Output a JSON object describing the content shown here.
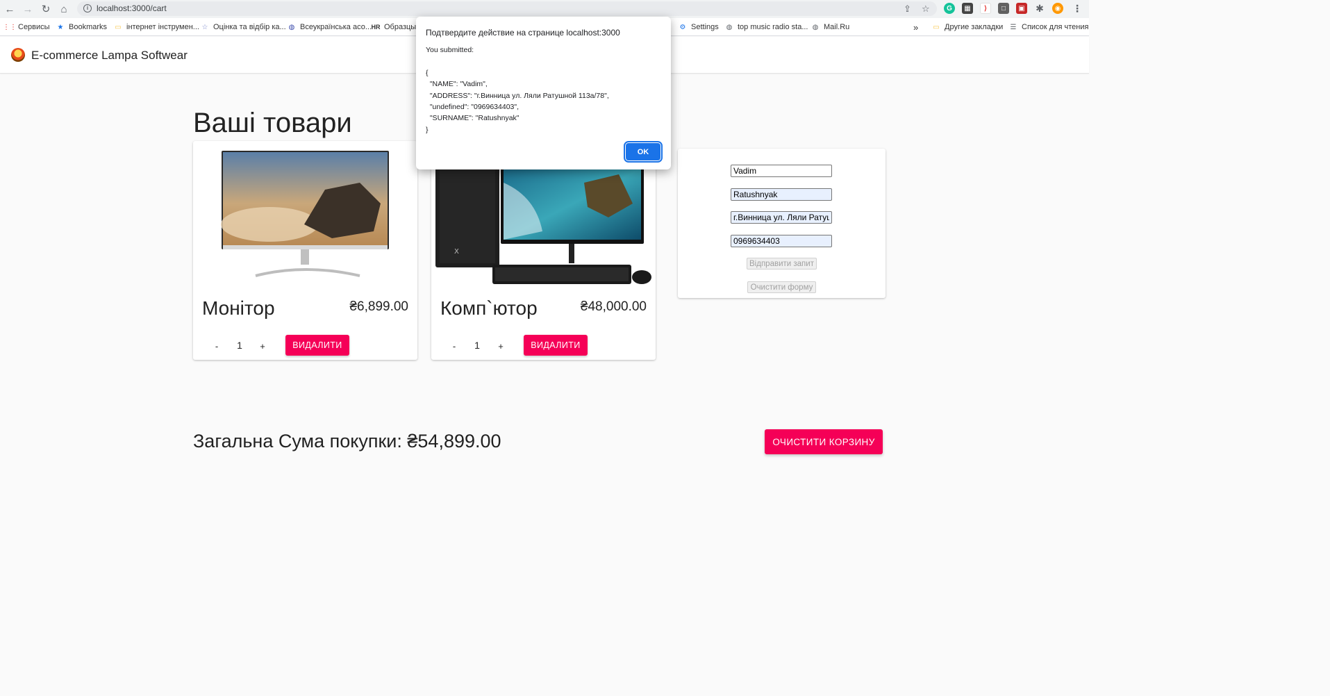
{
  "browser": {
    "url": "localhost:3000/cart",
    "bookmarks": [
      {
        "label": "Сервисы",
        "icon": "apps-grid-icon"
      },
      {
        "label": "Bookmarks",
        "icon": "star-icon"
      },
      {
        "label": "інтернет інструмен...",
        "icon": "folder-icon"
      },
      {
        "label": "Оцінка та відбір ка...",
        "icon": "star-outline-icon"
      },
      {
        "label": "Всеукраїнська асо...",
        "icon": "globe-icon"
      },
      {
        "label": "Образцы",
        "icon": "hr-icon"
      },
      {
        "label": "Settings",
        "icon": "gear-icon"
      },
      {
        "label": "top music radio sta...",
        "icon": "globe-icon"
      },
      {
        "label": "Mail.Ru",
        "icon": "globe-icon"
      },
      {
        "label": "Другие закладки",
        "icon": "folder-icon"
      },
      {
        "label": "Список для чтения",
        "icon": "reading-list-icon"
      }
    ],
    "more_label": "»"
  },
  "app": {
    "title": "E-commerce Lampa Softwear",
    "page_title": "Ваші товари"
  },
  "cart": {
    "items": [
      {
        "name": "Монітор",
        "price": "₴6,899.00",
        "quantity": "1",
        "minus": "-",
        "plus": "+",
        "delete_label": "ВИДАЛИТИ"
      },
      {
        "name": "Комп`ютор",
        "price": "₴48,000.00",
        "quantity": "1",
        "minus": "-",
        "plus": "+",
        "delete_label": "ВИДАЛИТИ"
      }
    ],
    "total_label": "Загальна Сума покупки: ₴54,899.00",
    "clear_label": "ОЧИСТИТИ КОРЗИНУ"
  },
  "form": {
    "name": "Vadim",
    "surname": "Ratushnyak",
    "address": "г.Винница ул. Ляли Ратушной 113а/78",
    "phone": "0969634403",
    "submit_label": "Відправити запит",
    "reset_label": "Очистити форму"
  },
  "dialog": {
    "title": "Подтвердите действие на странице localhost:3000",
    "message": "You submitted:\n\n{\n  \"NAME\": \"Vadim\",\n  \"ADDRESS\": \"г.Винница ул. Ляли Ратушной 113а/78\",\n  \"undefined\": \"0969634403\",\n  \"SURNAME\": \"Ratushnyak\"\n}",
    "ok_label": "OK"
  },
  "colors": {
    "accent": "#f50057",
    "dialog_button": "#1a73e8",
    "autofill": "#e8f0fe"
  }
}
